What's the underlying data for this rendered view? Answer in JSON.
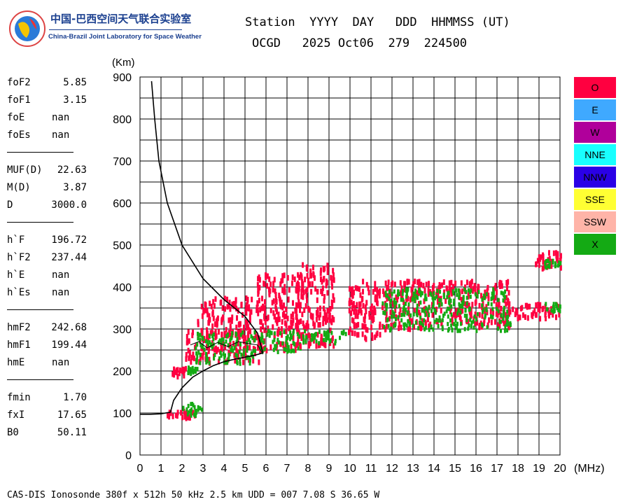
{
  "logo": {
    "chinese": "中国-巴西空间天气联合实验室",
    "english": "China-Brazil Joint Laboratory for Space Weather"
  },
  "header": {
    "line1": "Station  YYYY  DAY   DDD  HHMMSS (UT)",
    "line2": "OCGD   2025 Oct06  279  224500"
  },
  "parameters": [
    {
      "label": "foF2",
      "value": "5.85"
    },
    {
      "label": "foF1",
      "value": "3.15"
    },
    {
      "label": "foE",
      "value": "nan"
    },
    {
      "label": "foEs",
      "value": "nan"
    },
    {
      "label": "MUF(D)",
      "value": "22.63"
    },
    {
      "label": "M(D)",
      "value": "3.87"
    },
    {
      "label": "D",
      "value": "3000.0"
    },
    {
      "label": "h`F",
      "value": "196.72"
    },
    {
      "label": "h`F2",
      "value": "237.44"
    },
    {
      "label": "h`E",
      "value": "nan"
    },
    {
      "label": "h`Es",
      "value": "nan"
    },
    {
      "label": "hmF2",
      "value": "242.68"
    },
    {
      "label": "hmF1",
      "value": "199.44"
    },
    {
      "label": "hmE",
      "value": "nan"
    },
    {
      "label": "fmin",
      "value": "1.70"
    },
    {
      "label": "fxI",
      "value": "17.65"
    },
    {
      "label": "B0",
      "value": "50.11"
    }
  ],
  "legend": [
    {
      "label": "O",
      "color": "#ff0040"
    },
    {
      "label": "E",
      "color": "#3fa9ff"
    },
    {
      "label": "W",
      "color": "#b0009b"
    },
    {
      "label": "NNE",
      "color": "#19ffff"
    },
    {
      "label": "NNW",
      "color": "#2a00e6"
    },
    {
      "label": "SSE",
      "color": "#ffff33"
    },
    {
      "label": "SSW",
      "color": "#ffb4a8"
    },
    {
      "label": "X",
      "color": "#14aa14"
    }
  ],
  "footer": "CAS-DIS Ionosonde 380f x 512h 50 kHz 2.5 km UDD = 007 7.08 S 36.65 W",
  "chart_data": {
    "type": "scatter",
    "title": "",
    "xlabel": "(MHz)",
    "ylabel": "(Km)",
    "xlim": [
      0,
      20
    ],
    "ylim": [
      0,
      900
    ],
    "xticks": [
      "0",
      "1",
      "2",
      "3",
      "4",
      "5",
      "6",
      "7",
      "8",
      "9",
      "10",
      "11",
      "12",
      "13",
      "14",
      "15",
      "16",
      "17",
      "18",
      "19",
      "20"
    ],
    "yticks": [
      "0",
      "100",
      "200",
      "300",
      "400",
      "500",
      "600",
      "700",
      "800",
      "900"
    ],
    "grid": true,
    "legend_position": "right",
    "echo_clusters": [
      {
        "mode": "O",
        "x": [
          1.1,
          2.6
        ],
        "y": [
          92,
          110
        ]
      },
      {
        "mode": "X",
        "x": [
          2.0,
          2.9
        ],
        "y": [
          98,
          128
        ]
      },
      {
        "mode": "O",
        "x": [
          1.5,
          2.3
        ],
        "y": [
          193,
          212
        ]
      },
      {
        "mode": "X",
        "x": [
          2.2,
          2.7
        ],
        "y": [
          198,
          215
        ]
      },
      {
        "mode": "O",
        "x": [
          2.1,
          5.7
        ],
        "y": [
          225,
          300
        ]
      },
      {
        "mode": "O",
        "x": [
          2.7,
          5.3
        ],
        "y": [
          290,
          380
        ]
      },
      {
        "mode": "X",
        "x": [
          2.6,
          5.5
        ],
        "y": [
          222,
          300
        ]
      },
      {
        "mode": "O",
        "x": [
          5.5,
          7.6
        ],
        "y": [
          255,
          440
        ]
      },
      {
        "mode": "X",
        "x": [
          5.5,
          7.6
        ],
        "y": [
          250,
          300
        ]
      },
      {
        "mode": "O",
        "x": [
          7.4,
          9.2
        ],
        "y": [
          265,
          460
        ]
      },
      {
        "mode": "X",
        "x": [
          7.7,
          9.8
        ],
        "y": [
          270,
          300
        ]
      },
      {
        "mode": "O",
        "x": [
          9.9,
          11.4
        ],
        "y": [
          280,
          420
        ]
      },
      {
        "mode": "O",
        "x": [
          11.5,
          13.8
        ],
        "y": [
          305,
          420
        ]
      },
      {
        "mode": "O",
        "x": [
          13.8,
          17.6
        ],
        "y": [
          310,
          420
        ]
      },
      {
        "mode": "X",
        "x": [
          11.5,
          17.6
        ],
        "y": [
          300,
          400
        ]
      },
      {
        "mode": "O",
        "x": [
          17.7,
          20.0
        ],
        "y": [
          330,
          365
        ]
      },
      {
        "mode": "X",
        "x": [
          19.2,
          20.0
        ],
        "y": [
          345,
          365
        ]
      },
      {
        "mode": "O",
        "x": [
          18.8,
          20.0
        ],
        "y": [
          450,
          488
        ]
      },
      {
        "mode": "X",
        "x": [
          19.2,
          20.0
        ],
        "y": [
          450,
          468
        ]
      }
    ],
    "profile_line": {
      "x": [
        0.55,
        0.7,
        0.9,
        1.3,
        2.0,
        3.0,
        4.0,
        5.0,
        5.6,
        5.85
      ],
      "y": [
        890,
        800,
        700,
        600,
        500,
        420,
        370,
        330,
        290,
        243
      ]
    },
    "trace_line": {
      "x": [
        0.0,
        0.5,
        1.0,
        1.45,
        1.6,
        2.0,
        2.5,
        3.0,
        3.5,
        4.0,
        4.5,
        5.0,
        5.5,
        5.85
      ],
      "y": [
        97,
        97,
        98,
        102,
        130,
        160,
        185,
        200,
        213,
        222,
        228,
        233,
        238,
        243
      ]
    },
    "f2_trace": {
      "x": [
        2.4,
        2.8,
        3.2,
        3.7,
        4.2,
        4.7,
        5.2,
        5.6,
        5.85
      ],
      "y": [
        262,
        270,
        255,
        268,
        258,
        270,
        265,
        262,
        240
      ]
    }
  }
}
